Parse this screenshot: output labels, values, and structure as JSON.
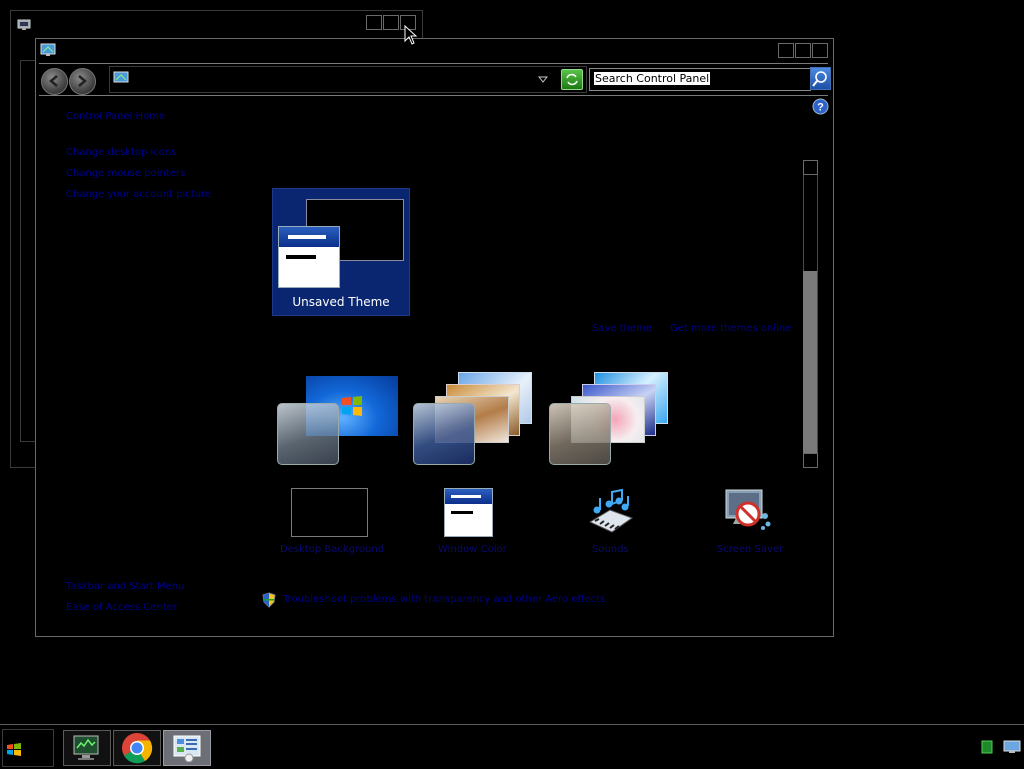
{
  "background_window": {
    "title": ""
  },
  "main_window": {
    "title": "",
    "address": {
      "path": ""
    },
    "search": {
      "placeholder": "Search Control Panel"
    },
    "left_links": [
      "Control Panel Home",
      "Change desktop icons",
      "Change mouse pointers",
      "Change your account picture"
    ],
    "see_also_links": [
      "Taskbar and Start Menu",
      "Ease of Access Center"
    ],
    "top_right_links": [
      "Save theme",
      "Get more themes online"
    ],
    "themes": {
      "my_themes": [
        {
          "label": "Unsaved Theme",
          "selected": true
        }
      ],
      "aero_themes": [
        {
          "label": ""
        },
        {
          "label": ""
        },
        {
          "label": ""
        }
      ]
    },
    "bottom_items": [
      {
        "label": "Desktop Background",
        "icon": "black-desktop-icon"
      },
      {
        "label": "Window Color",
        "icon": "window-color-icon"
      },
      {
        "label": "Sounds",
        "icon": "sounds-icon"
      },
      {
        "label": "Screen Saver",
        "icon": "screen-saver-icon"
      }
    ],
    "uac_link": "Troubleshoot problems with transparency and other Aero effects"
  },
  "taskbar": {
    "items": [
      "system-monitor-icon",
      "chrome-icon",
      "control-panel-icon"
    ],
    "tray": [
      "tray-green-icon",
      "tray-network-icon"
    ]
  },
  "colors": {
    "selection": "#0a2670",
    "link": "#00008b",
    "accent": "#1d4fa6"
  }
}
